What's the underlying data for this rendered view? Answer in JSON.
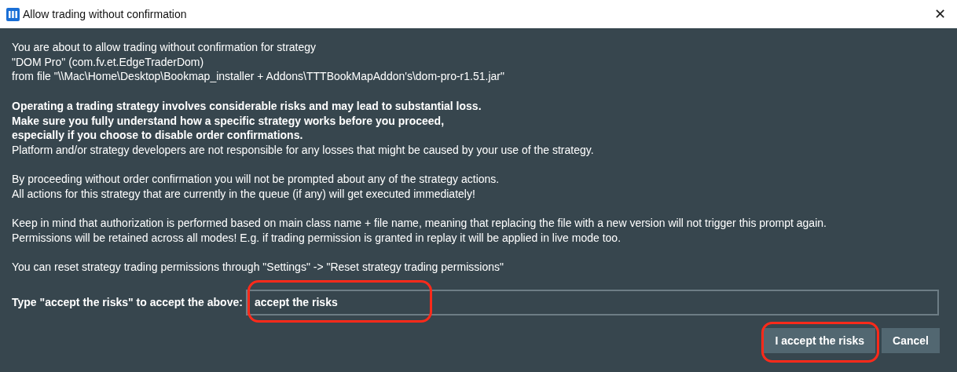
{
  "window": {
    "title": "Allow trading without confirmation",
    "close": "✕"
  },
  "paragraphs": [
    [
      "You are about to allow trading without confirmation for strategy",
      "\"DOM Pro\" (com.fv.et.EdgeTraderDom)",
      "from file \"\\\\Mac\\Home\\Desktop\\Bookmap_installer + Addons\\TTTBookMapAddon's\\dom-pro-r1.51.jar\""
    ],
    [
      "**Operating a trading strategy involves considerable risks and may lead to substantial loss.**",
      "**Make sure you fully understand how a specific strategy works before you proceed,**",
      "**especially if you choose to disable order confirmations.**",
      "Platform and/or strategy developers are not responsible for any losses that might be caused by your use of the strategy."
    ],
    [
      "By proceeding without order confirmation you will not be prompted about any of the strategy actions.",
      "All actions for this strategy that are currently in the queue (if any) will get executed immediately!"
    ],
    [
      "Keep in mind that authorization is performed based on main class name + file name, meaning that replacing the file with a new version will not trigger this prompt again.",
      "Permissions will be retained across all modes! E.g. if trading permission is granted in replay it will be applied in live mode too."
    ],
    [
      "You can reset strategy trading permissions through \"Settings\" -> \"Reset strategy trading permissions\""
    ]
  ],
  "confirm": {
    "label": "Type \"accept the risks\" to accept the above:",
    "value": "accept the risks",
    "highlighted": true
  },
  "buttons": [
    {
      "label": "I accept the risks",
      "highlighted": true
    },
    {
      "label": "Cancel",
      "highlighted": false
    }
  ]
}
